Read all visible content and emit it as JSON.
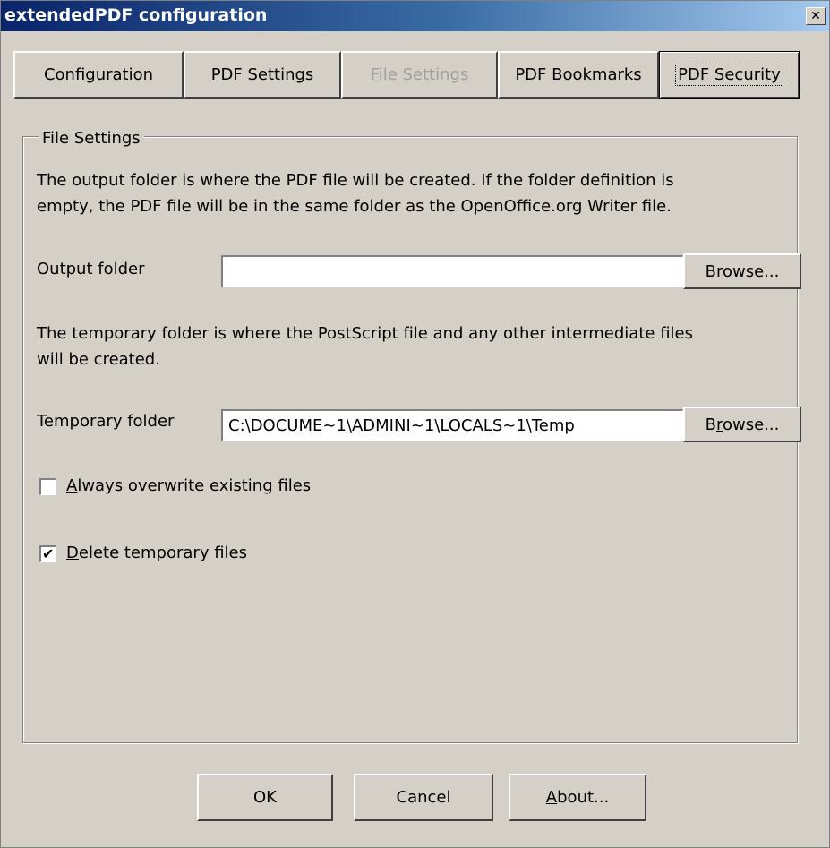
{
  "window": {
    "title": "extendedPDF configuration",
    "close_glyph": "✕"
  },
  "tabs": [
    {
      "label_pre": "",
      "label_mn": "C",
      "label_post": "onfiguration",
      "disabled": false
    },
    {
      "label_pre": "",
      "label_mn": "P",
      "label_post": "DF Settings",
      "disabled": false
    },
    {
      "label_pre": "",
      "label_mn": "F",
      "label_post": "ile Settings",
      "disabled": true
    },
    {
      "label_pre": "PDF ",
      "label_mn": "B",
      "label_post": "ookmarks",
      "disabled": false
    },
    {
      "label_pre": "PDF ",
      "label_mn": "S",
      "label_post": "ecurity",
      "disabled": false
    }
  ],
  "group": {
    "title": "File Settings",
    "output_desc_line1": "The output folder is where the PDF file will be created.   If the folder definition is",
    "output_desc_line2": "empty, the PDF file will be in the same folder as the OpenOffice.org Writer file.",
    "output_label": "Output folder",
    "output_value": "",
    "browse1_pre": "Bro",
    "browse1_mn": "w",
    "browse1_post": "se...",
    "temp_desc_line1": "The temporary folder is where the PostScript file and any other intermediate files",
    "temp_desc_line2": "will be created.",
    "temp_label": "Temporary folder",
    "temp_value": "C:\\DOCUME~1\\ADMINI~1\\LOCALS~1\\Temp",
    "browse2_pre": "B",
    "browse2_mn": "r",
    "browse2_post": "owse...",
    "overwrite_mn": "A",
    "overwrite_post": "lways overwrite existing files",
    "overwrite_checked": false,
    "delete_mn": "D",
    "delete_post": "elete temporary files",
    "delete_checked": true,
    "check_glyph": "✔"
  },
  "footer": {
    "ok_label": "OK",
    "cancel_label": "Cancel",
    "about_mn": "A",
    "about_post": "bout..."
  }
}
